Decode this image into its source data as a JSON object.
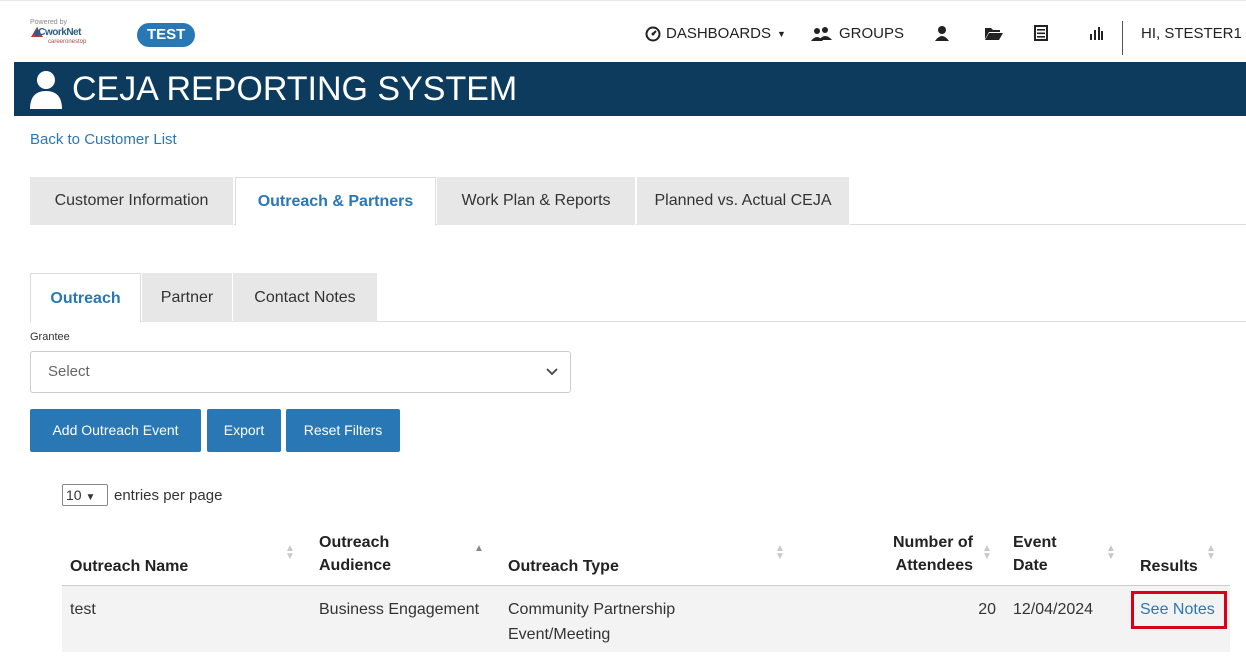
{
  "header": {
    "logo": {
      "line1": "Powered by",
      "line2": "iCworkNet",
      "line3": "careeronestop"
    },
    "badge": "TEST",
    "nav": {
      "dashboards": "DASHBOARDS",
      "groups": "GROUPS",
      "user_greeting": "HI, STESTER1"
    }
  },
  "title": "CEJA REPORTING SYSTEM",
  "back_link": "Back to Customer List",
  "main_tabs": [
    {
      "label": "Customer Information"
    },
    {
      "label": "Outreach & Partners"
    },
    {
      "label": "Work Plan & Reports"
    },
    {
      "label": "Planned vs. Actual CEJA"
    }
  ],
  "sub_tabs": [
    {
      "label": "Outreach"
    },
    {
      "label": "Partner"
    },
    {
      "label": "Contact Notes"
    }
  ],
  "filters": {
    "grantee_label": "Grantee",
    "grantee_value": "Select"
  },
  "buttons": {
    "add": "Add Outreach Event",
    "export": "Export",
    "reset": "Reset Filters"
  },
  "paging": {
    "value": "10",
    "label": "entries per page"
  },
  "table": {
    "columns": {
      "name": "Outreach Name",
      "audience_1": "Outreach",
      "audience_2": "Audience",
      "type": "Outreach Type",
      "attendees_1": "Number of",
      "attendees_2": "Attendees",
      "date_1": "Event",
      "date_2": "Date",
      "results": "Results"
    },
    "rows": [
      {
        "name": "test",
        "audience": "Business Engagement",
        "type_1": "Community Partnership",
        "type_2": "Event/Meeting",
        "attendees": "20",
        "date": "12/04/2024",
        "results": "See Notes"
      }
    ]
  }
}
